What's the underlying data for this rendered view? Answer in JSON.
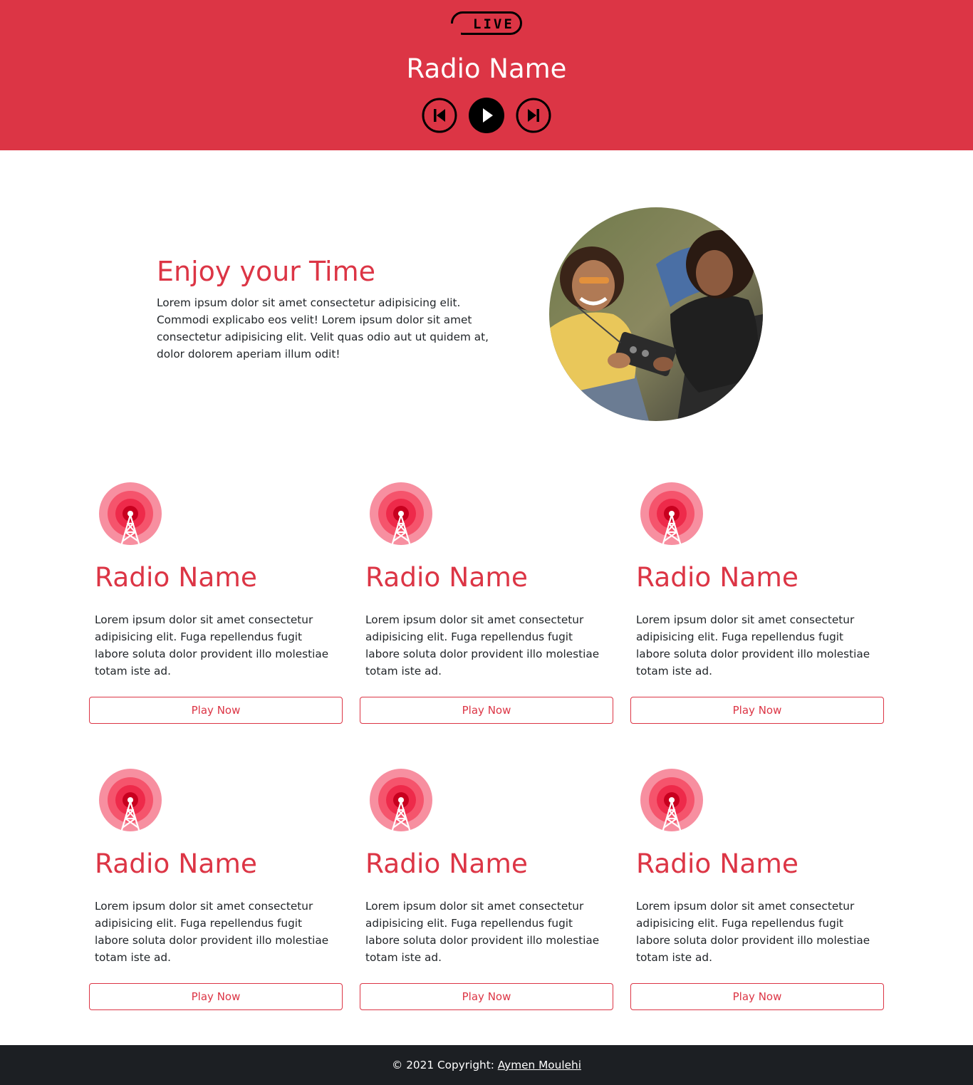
{
  "header": {
    "live_badge": "LIVE",
    "title": "Radio Name",
    "controls": {
      "previous_icon": "skip-previous-icon",
      "play_icon": "play-icon",
      "next_icon": "skip-next-icon"
    },
    "background_color": "#dc3545"
  },
  "hero": {
    "title": "Enjoy your Time",
    "text": "Lorem ipsum dolor sit amet consectetur adipisicing elit. Commodi explicabo eos velit! Lorem ipsum dolor sit amet consectetur adipisicing elit. Velit quas odio aut ut quidem at, dolor dolorem aperiam illum odit!",
    "image": "photo-two-women-with-radio"
  },
  "cards": [
    {
      "icon": "radio-tower-icon",
      "title": "Radio Name",
      "text": "Lorem ipsum dolor sit amet consectetur adipisicing elit. Fuga repellendus fugit labore soluta dolor provident illo molestiae totam iste ad.",
      "button": "Play Now"
    },
    {
      "icon": "radio-tower-icon",
      "title": "Radio Name",
      "text": "Lorem ipsum dolor sit amet consectetur adipisicing elit. Fuga repellendus fugit labore soluta dolor provident illo molestiae totam iste ad.",
      "button": "Play Now"
    },
    {
      "icon": "radio-tower-icon",
      "title": "Radio Name",
      "text": "Lorem ipsum dolor sit amet consectetur adipisicing elit. Fuga repellendus fugit labore soluta dolor provident illo molestiae totam iste ad.",
      "button": "Play Now"
    },
    {
      "icon": "radio-tower-icon",
      "title": "Radio Name",
      "text": "Lorem ipsum dolor sit amet consectetur adipisicing elit. Fuga repellendus fugit labore soluta dolor provident illo molestiae totam iste ad.",
      "button": "Play Now"
    },
    {
      "icon": "radio-tower-icon",
      "title": "Radio Name",
      "text": "Lorem ipsum dolor sit amet consectetur adipisicing elit. Fuga repellendus fugit labore soluta dolor provident illo molestiae totam iste ad.",
      "button": "Play Now"
    },
    {
      "icon": "radio-tower-icon",
      "title": "Radio Name",
      "text": "Lorem ipsum dolor sit amet consectetur adipisicing elit. Fuga repellendus fugit labore soluta dolor provident illo molestiae totam iste ad.",
      "button": "Play Now"
    }
  ],
  "footer": {
    "copyright": "© 2021 Copyright: ",
    "author_link": "Aymen Moulehi",
    "background_color": "#1c1f23"
  },
  "colors": {
    "accent": "#dc3545",
    "text": "#212529"
  }
}
